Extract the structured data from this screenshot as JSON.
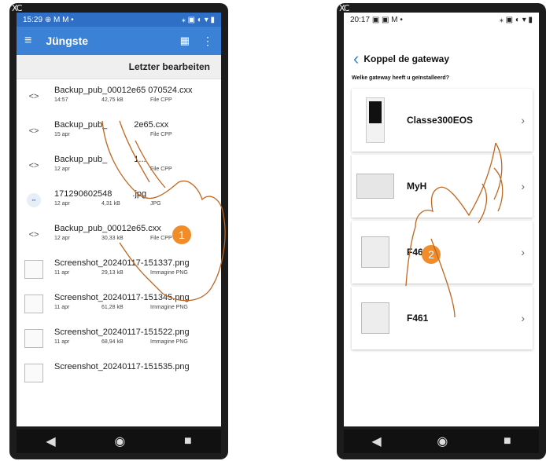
{
  "phone1": {
    "corner": "XC",
    "status": {
      "time": "15:29",
      "icons_left": "⊕ M M •",
      "icons_right": "⁎ ▣ ◐ ▾ ▮"
    },
    "appbar": {
      "title": "Jüngste",
      "grid_icon": "▦",
      "more_icon": "⋮",
      "menu_icon": "≡"
    },
    "sort_label": "Letzter bearbeiten",
    "files": [
      {
        "name": "Backup_pub_00012e65 070524.cxx",
        "date": "14:57",
        "size": "42,75 kB",
        "type": "File CPP",
        "icon": "<>"
      },
      {
        "name": "Backup_pub_",
        "name2": "2e65.cxx",
        "date": "15 apr",
        "size": "",
        "type": "File CPP",
        "icon": "<>"
      },
      {
        "name": "Backup_pub_",
        "name2": "1...",
        "date": "12 apr",
        "size": "",
        "type": "File CPP",
        "icon": "<>"
      },
      {
        "name": "171290602548",
        "name2": ".jpg",
        "date": "12 apr",
        "size": "4,31 kB",
        "type": "JPG",
        "icon": "img"
      },
      {
        "name": "Backup_pub_00012e65.cxx",
        "date": "12 apr",
        "size": "30,33 kB",
        "type": "File CPP",
        "icon": "<>"
      },
      {
        "name": "Screenshot_20240117-151337.png",
        "date": "11 apr",
        "size": "29,13 kB",
        "type": "Immagine PNG",
        "icon": "thumb"
      },
      {
        "name": "Screenshot_20240117-151345.png",
        "date": "11 apr",
        "size": "61,28 kB",
        "type": "Immagine PNG",
        "icon": "thumb"
      },
      {
        "name": "Screenshot_20240117-151522.png",
        "date": "11 apr",
        "size": "68,94 kB",
        "type": "Immagine PNG",
        "icon": "thumb"
      },
      {
        "name": "Screenshot_20240117-151535.png",
        "date": "",
        "size": "",
        "type": "",
        "icon": "thumb"
      }
    ],
    "badge": "1"
  },
  "phone2": {
    "corner": "XC",
    "status": {
      "time": "20:17",
      "icons_left": "▣ ▣ M •",
      "icons_right": "⁎ ▣ ◐ ▾ ▮"
    },
    "title": "Koppel de gateway",
    "question": "Welke gateway heeft u geïnstalleerd?",
    "gateways": [
      {
        "label": "Classe300EOS"
      },
      {
        "label": "MyH"
      },
      {
        "label": "F46"
      },
      {
        "label": "F461"
      }
    ],
    "badge": "2"
  },
  "nav": {
    "back": "◀",
    "home": "◉",
    "recents": "■"
  },
  "colors": {
    "accent": "#3b82d6",
    "badge": "#f08c2a"
  }
}
